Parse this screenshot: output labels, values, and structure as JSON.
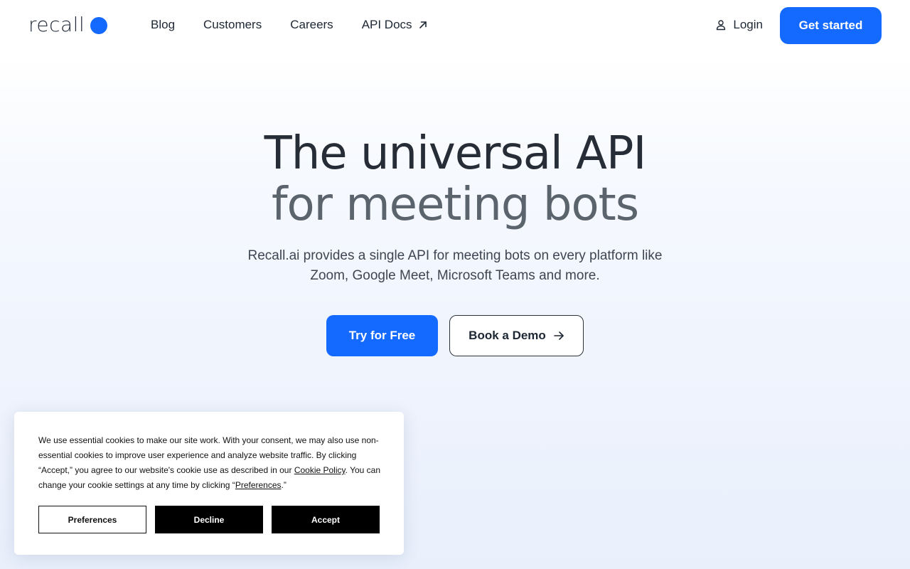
{
  "brand": {
    "name": "recall",
    "accent": "#1469ff"
  },
  "nav": {
    "links": [
      {
        "label": "Blog"
      },
      {
        "label": "Customers"
      },
      {
        "label": "Careers"
      },
      {
        "label": "API Docs",
        "icon": "external-arrow-icon"
      }
    ],
    "login_label": "Login",
    "login_icon": "user-icon",
    "cta_label": "Get started"
  },
  "hero": {
    "title_line1": "The universal API",
    "title_line2": "for meeting bots",
    "subtitle": "Recall.ai provides a single API for meeting bots on every platform like Zoom, Google Meet, Microsoft Teams and more.",
    "primary_cta": "Try for Free",
    "secondary_cta": "Book a Demo",
    "secondary_icon": "arrow-right-icon"
  },
  "cookie": {
    "text_before_policy": "We use essential cookies to make our site work. With your consent, we may also use non-essential cookies to improve user experience and analyze website traffic. By clicking “Accept,” you agree to our website's cookie use as described in our ",
    "policy_link": "Cookie Policy",
    "text_middle": ". You can change your cookie settings at any time by clicking “",
    "preferences_link": "Preferences",
    "text_end": ".”",
    "buttons": {
      "preferences": "Preferences",
      "decline": "Decline",
      "accept": "Accept"
    }
  }
}
